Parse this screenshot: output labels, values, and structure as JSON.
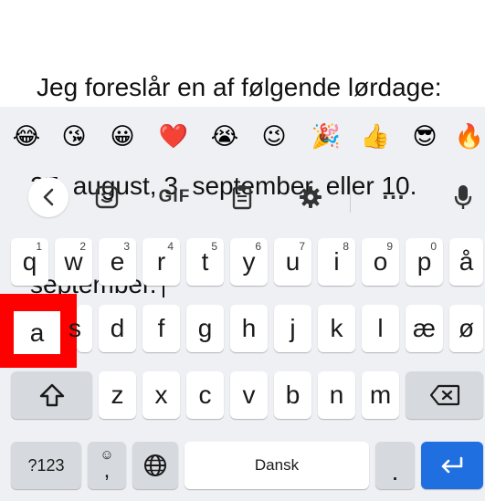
{
  "compose": {
    "line1": "Jeg foreslår en af følgende lørdage:",
    "line2": "27. august, 3. september, eller 10.",
    "line3": "september."
  },
  "emoji_row": {
    "items": [
      "😂",
      "😘",
      "😀",
      "❤️",
      "😭",
      "😉",
      "🎉",
      "👍",
      "😎",
      "🔥"
    ]
  },
  "toolbar": {
    "gif_label": "GIF",
    "more_label": "···"
  },
  "keyboard": {
    "row1": [
      {
        "label": "q",
        "hint": "1"
      },
      {
        "label": "w",
        "hint": "2"
      },
      {
        "label": "e",
        "hint": "3"
      },
      {
        "label": "r",
        "hint": "4"
      },
      {
        "label": "t",
        "hint": "5"
      },
      {
        "label": "y",
        "hint": "6"
      },
      {
        "label": "u",
        "hint": "7"
      },
      {
        "label": "i",
        "hint": "8"
      },
      {
        "label": "o",
        "hint": "9"
      },
      {
        "label": "p",
        "hint": "0"
      },
      {
        "label": "å",
        "hint": ""
      }
    ],
    "row2": [
      "a",
      "s",
      "d",
      "f",
      "g",
      "h",
      "j",
      "k",
      "l",
      "æ",
      "ø"
    ],
    "row3": [
      "z",
      "x",
      "c",
      "v",
      "b",
      "n",
      "m"
    ],
    "sym_label": "?123",
    "comma_label": ",",
    "comma_hint": "☺",
    "space_label": "Dansk",
    "period_label": "."
  },
  "colors": {
    "highlight": "#ff0000",
    "enter_key": "#1f6fe0"
  }
}
